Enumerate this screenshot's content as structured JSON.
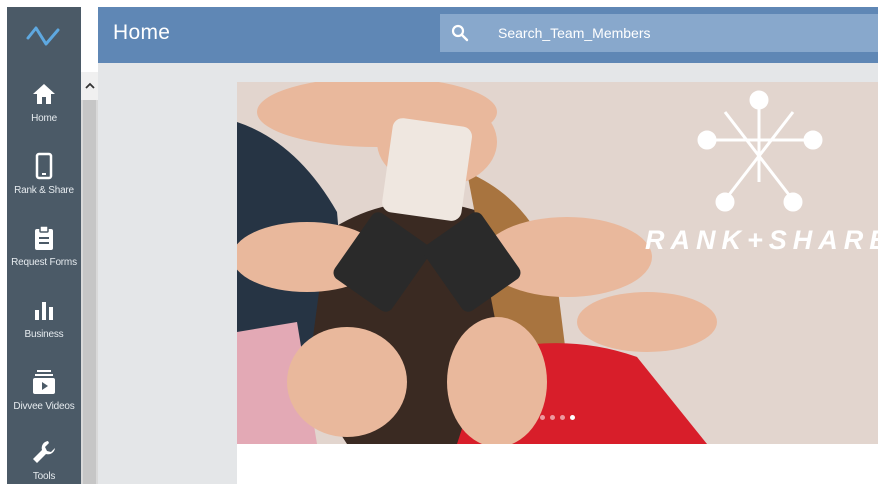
{
  "sidebar": {
    "items": [
      {
        "label": "Home",
        "icon": "home-icon"
      },
      {
        "label": "Rank & Share",
        "icon": "phone-icon"
      },
      {
        "label": "Request Forms",
        "icon": "clipboard-icon"
      },
      {
        "label": "Business",
        "icon": "bar-chart-icon"
      },
      {
        "label": "Divvee Videos",
        "icon": "video-icon"
      },
      {
        "label": "Tools",
        "icon": "wrench-icon"
      }
    ]
  },
  "header": {
    "title": "Home",
    "search_placeholder": "Search_Team_Members"
  },
  "hero": {
    "brand_text": "RANK+SHARE",
    "slide_count": 4,
    "active_slide": 4
  },
  "colors": {
    "sidebar": "#4b5a67",
    "header": "#5f87b5",
    "search": "#88a8cc",
    "content_bg": "#e4e6e8"
  }
}
